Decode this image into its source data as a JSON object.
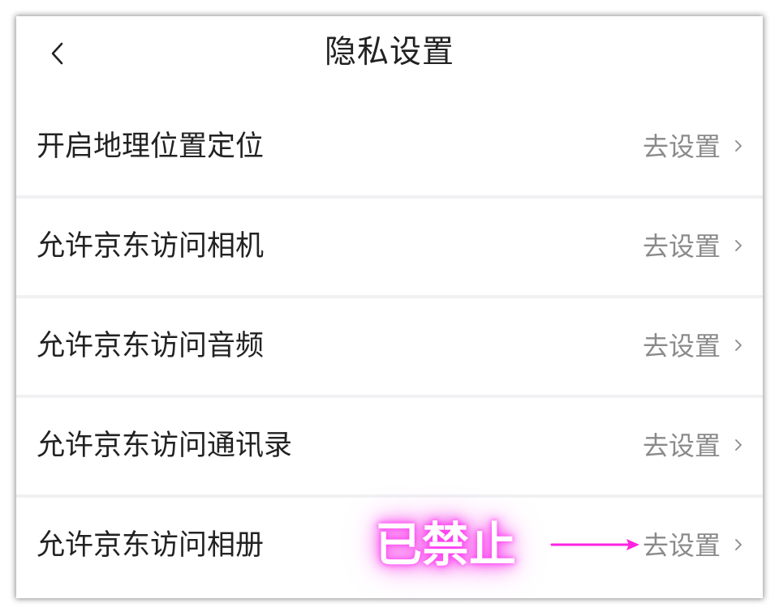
{
  "header": {
    "title": "隐私设置",
    "back_icon": "chevron-left-icon"
  },
  "rows": [
    {
      "label": "开启地理位置定位",
      "action": "去设置",
      "icon": "chevron-right-icon"
    },
    {
      "label": "允许京东访问相机",
      "action": "去设置",
      "icon": "chevron-right-icon"
    },
    {
      "label": "允许京东访问音频",
      "action": "去设置",
      "icon": "chevron-right-icon"
    },
    {
      "label": "允许京东访问通讯录",
      "action": "去设置",
      "icon": "chevron-right-icon"
    },
    {
      "label": "允许京东访问相册",
      "action": "去设置",
      "icon": "chevron-right-icon"
    }
  ],
  "annotation": {
    "text": "已禁止",
    "glow_color": "#ff38f2",
    "arrow_color": "#ff22e0"
  },
  "colors": {
    "text_primary": "#222222",
    "text_secondary": "#8a8a8a",
    "separator": "#f1f1f3",
    "background": "#ffffff"
  }
}
